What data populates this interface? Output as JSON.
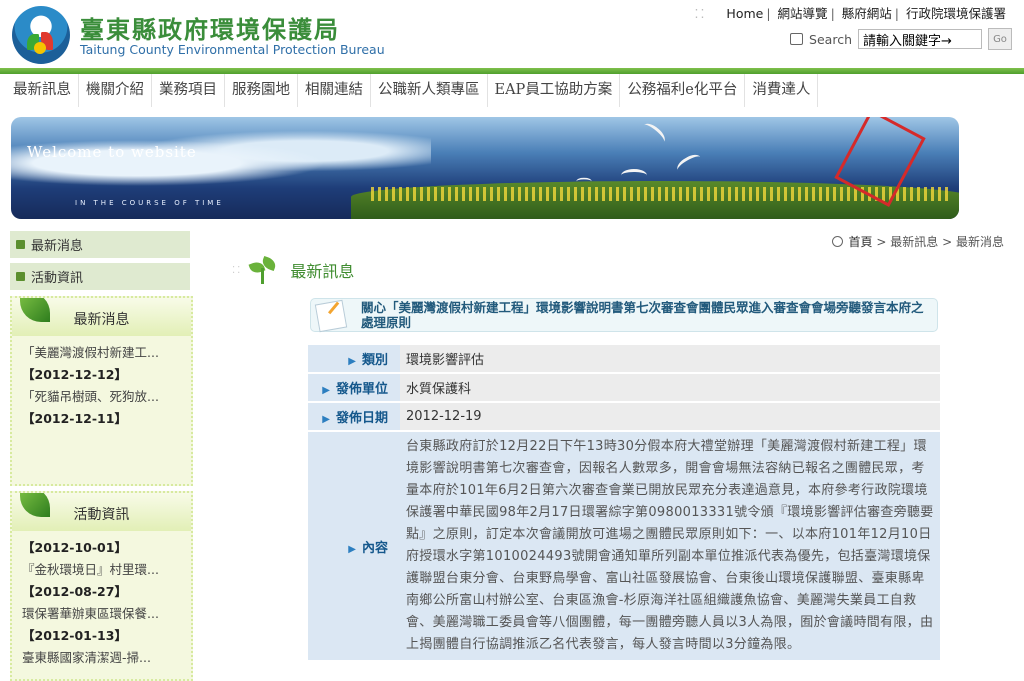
{
  "site": {
    "title_zh": "臺東縣政府環境保護局",
    "title_en": "Taitung County Environmental Protection Bureau"
  },
  "top_links": {
    "home": "Home",
    "sitemap": "網站導覽",
    "county": "縣府網站",
    "epa": "行政院環境保護署"
  },
  "search": {
    "label": "Search",
    "value": "請輸入關鍵字→",
    "go": "Go"
  },
  "nav": {
    "items": [
      "最新訊息",
      "機關介紹",
      "業務項目",
      "服務園地",
      "相關連結",
      "公職新人類專區",
      "EAP員工協助方案",
      "公務福利e化平台",
      "消費達人"
    ]
  },
  "banner": {
    "welcome": "Welcome to website",
    "course": "IN THE COURSE OF TIME"
  },
  "sidebar": {
    "links": [
      "最新消息",
      "活動資訊"
    ],
    "news_box": {
      "title": "最新消息",
      "items": [
        "「美麗灣渡假村新建工...",
        "【2012-12-12】",
        "「死貓吊樹頭、死狗放...",
        "【2012-12-11】"
      ]
    },
    "activity_box": {
      "title": "活動資訊",
      "items": [
        "【2012-10-01】",
        "『金秋環境日』村里環...",
        "【2012-08-27】",
        "環保署華辦東區環保餐...",
        "【2012-01-13】",
        "臺東縣國家清潔週-掃..."
      ]
    }
  },
  "breadcrumb": {
    "home": "首頁",
    "level1": "最新訊息",
    "current": "最新消息",
    "sep": ">"
  },
  "section": {
    "title": "最新訊息"
  },
  "article": {
    "title": "關心「美麗灣渡假村新建工程」環境影響說明書第七次審查會團體民眾進入審查會會場旁聽發言本府之處理原則",
    "rows": [
      {
        "label": "類別",
        "value": "環境影響評估"
      },
      {
        "label": "發佈單位",
        "value": "水質保護科"
      },
      {
        "label": "發佈日期",
        "value": "2012-12-19"
      }
    ],
    "content_label": "內容",
    "content": "台東縣政府訂於12月22日下午13時30分假本府大禮堂辦理「美麗灣渡假村新建工程」環境影響說明書第七次審查會，因報名人數眾多，開會會場無法容納已報名之團體民眾，考量本府於101年6月2日第六次審查會業已開放民眾充分表達過意見，本府參考行政院環境保護署中華民國98年2月17日環署綜字第0980013331號令頒『環境影響評估審查旁聽要點』之原則，訂定本次會議開放可進場之團體民眾原則如下：一、以本府101年12月10日府授環水字第1010024493號開會通知單所列副本單位推派代表為優先，包括臺灣環境保護聯盟台東分會、台東野鳥學會、富山社區發展協會、台東後山環境保護聯盟、臺東縣卑南鄉公所富山村辦公室、台東區漁會-杉原海洋社區組織護魚協會、美麗灣失業員工自救會、美麗灣職工委員會等八個團體，每一團體旁聽人員以3人為限，囿於會議時間有限，由上揭團體自行協調推派乙名代表發言，每人發言時間以3分鐘為限。"
  },
  "colors": {
    "green_accent": "#4f9f2e",
    "label_blue": "#15588c",
    "section_green": "#3f8c2f"
  }
}
